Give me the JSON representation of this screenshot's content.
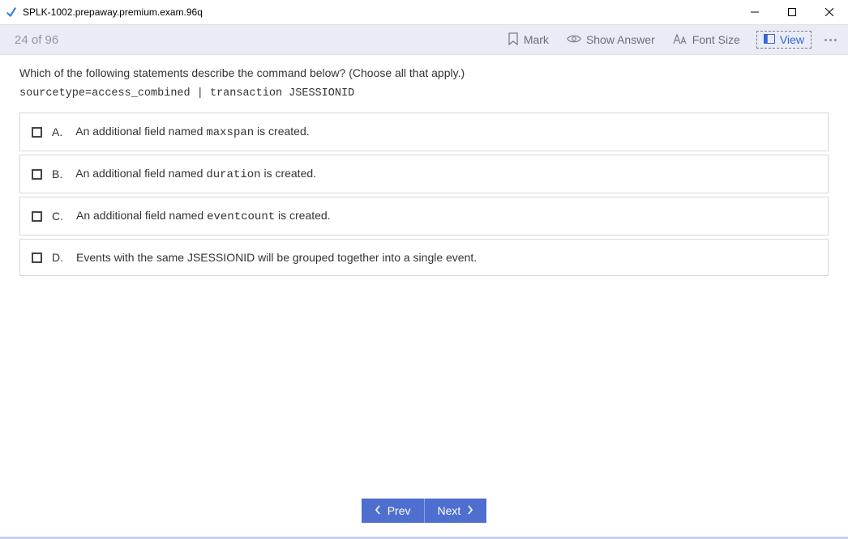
{
  "window": {
    "title": "SPLK-1002.prepaway.premium.exam.96q"
  },
  "toolbar": {
    "counter": "24 of 96",
    "mark": "Mark",
    "show_answer": "Show Answer",
    "font_size": "Font Size",
    "view": "View"
  },
  "question": {
    "prompt": "Which of the following statements describe the command below? (Choose all that apply.)",
    "code": "sourcetype=access_combined | transaction JSESSIONID"
  },
  "options": {
    "a": {
      "letter": "A.",
      "pre": "An additional field named ",
      "code": "maxspan",
      "post": " is created."
    },
    "b": {
      "letter": "B.",
      "pre": "An additional field named ",
      "code": "duration",
      "post": " is created."
    },
    "c": {
      "letter": "C.",
      "pre": "An additional field named ",
      "code": "eventcount",
      "post": " is created."
    },
    "d": {
      "letter": "D.",
      "text": "Events with the same JSESSIONID will be grouped together into a single event."
    }
  },
  "nav": {
    "prev": "Prev",
    "next": "Next"
  }
}
